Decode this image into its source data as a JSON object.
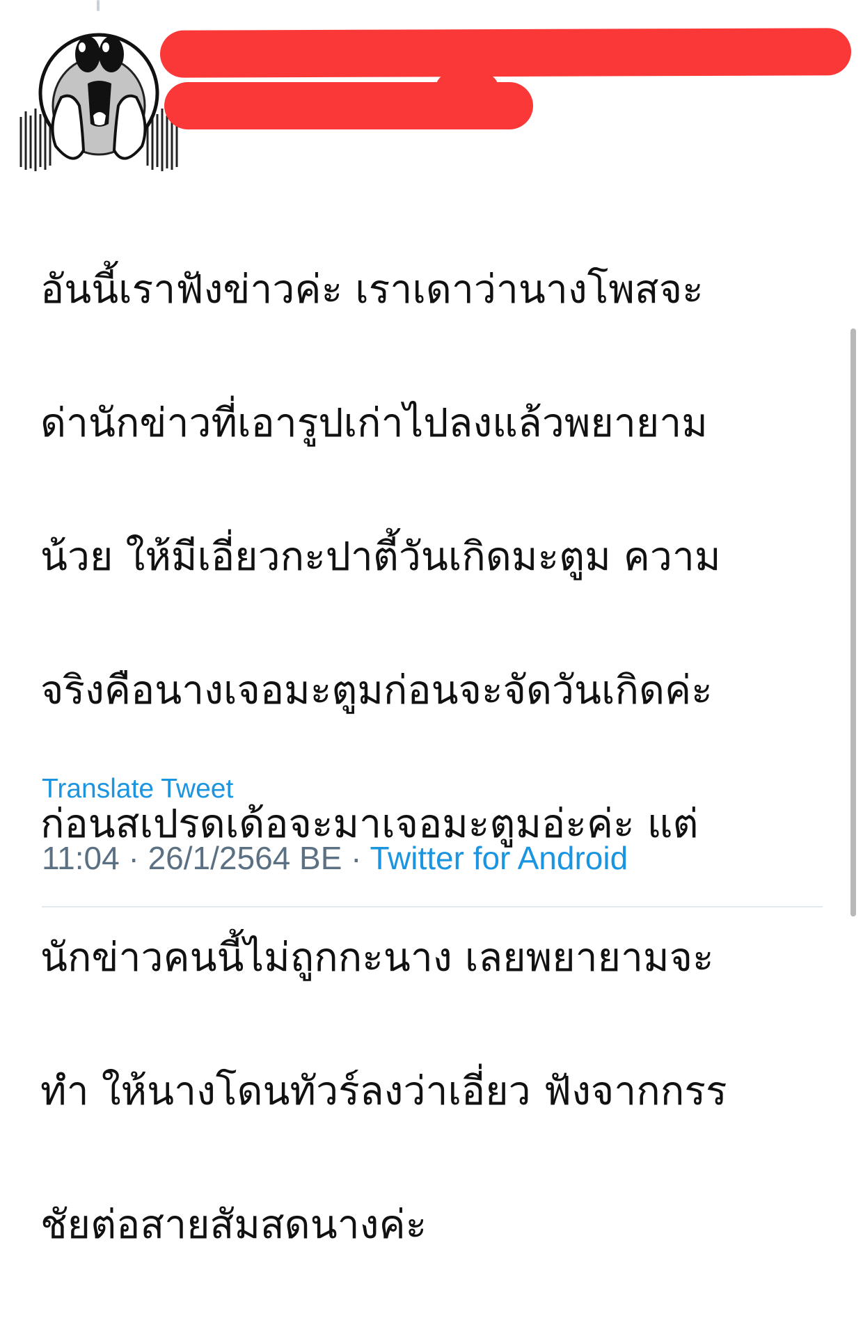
{
  "tweet": {
    "text_lines": [
      "อันนี้เราฟังข่าวค่ะ เราเดาว่านางโพสจะ",
      "ด่านักข่าวที่เอารูปเก่าไปลงแล้วพยายาม",
      "น้วย ให้มีเอี่ยวกะปาตี้วันเกิดมะตูม ความ",
      "จริงคือนางเจอมะตูมก่อนจะจัดวันเกิดค่ะ",
      "ก่อนสเปรดเด้อจะมาเจอมะตูมอ่ะค่ะ แต่",
      "นักข่าวคนนี้ไม่ถูกกะนาง เลยพยายามจะ",
      "ทำ ให้นางโดนทัวร์ลงว่าเอี่ยว ฟังจากกรร",
      "ชัยต่อสายสัมสดนางค่ะ"
    ],
    "translate_label": "Translate Tweet",
    "time": "11:04",
    "date": "26/1/2564 BE",
    "separator": " · ",
    "source": "Twitter for Android"
  },
  "author": {
    "avatar_icon": "shocked-face-sticker-icon",
    "name_redacted_color": "#fb3838"
  },
  "colors": {
    "link": "#1b95e0",
    "meta": "#5b7083",
    "text": "#111111"
  }
}
